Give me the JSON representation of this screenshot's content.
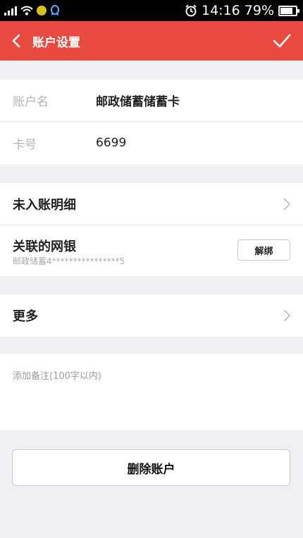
{
  "status_bar": {
    "time": "14:16",
    "battery": "79%",
    "battery_level": 0.79,
    "icons": [
      "signal-icon",
      "wifi-icon",
      "app-notification-icon",
      "qq-icon",
      "alarm-icon",
      "battery-icon"
    ]
  },
  "navbar": {
    "title": "账户设置",
    "back_icon": "back-arrow-icon",
    "confirm_icon": "checkmark-icon",
    "background": "#e84a3f"
  },
  "account": {
    "name_label": "账户名",
    "name_value": "邮政储蓄储蓄卡",
    "card_label": "卡号",
    "card_value": "6699"
  },
  "settings": {
    "unposted_label": "未入账明细",
    "linked_bank_label": "关联的网银",
    "linked_bank_account": "邮政储蓄4****************5",
    "unbind_label": "解绑",
    "more_label": "更多"
  },
  "remark": {
    "placeholder": "添加备注(100字以内)",
    "value": ""
  },
  "actions": {
    "delete_label": "删除账户"
  }
}
